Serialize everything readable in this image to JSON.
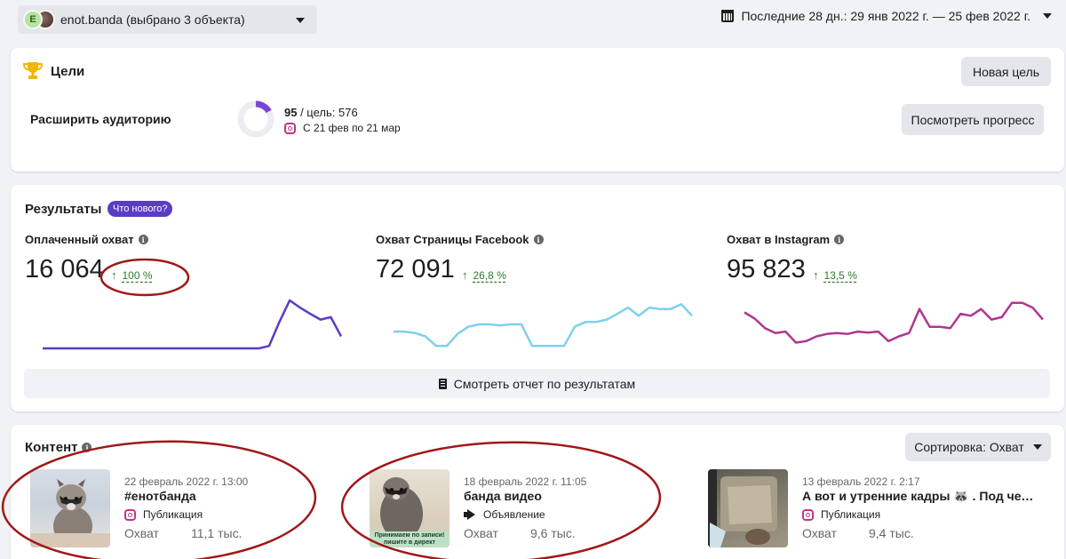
{
  "account": {
    "avatar_letter": "E",
    "label": "enot.banda (выбрано 3 объекта)"
  },
  "date_range": {
    "label": "Последние 28 дн.: 29 янв 2022 г. — 25 фев 2022 г."
  },
  "goals": {
    "title": "Цели",
    "new_goal_button": "Новая цель",
    "goal_name": "Расширить аудиторию",
    "current": "95",
    "target_text": " / цель: 576",
    "progress_fraction": 0.165,
    "dates": "С 21 фев по 21 мар",
    "view_progress_button": "Посмотреть прогресс"
  },
  "results": {
    "title": "Результаты",
    "whats_new": "Что нового?",
    "metrics": [
      {
        "label": "Оплаченный охват",
        "value": "16 064",
        "change": "100 %",
        "color": "#5b3cc4",
        "series": [
          0,
          0,
          0,
          0,
          0,
          0,
          0,
          0,
          0,
          0,
          0,
          0,
          0,
          0,
          0,
          0,
          0,
          0,
          0,
          0,
          0,
          0,
          0.05,
          0.55,
          1,
          0.85,
          0.72,
          0.6,
          0.65,
          0.25
        ]
      },
      {
        "label": "Охват Страницы Facebook",
        "value": "72 091",
        "change": "26,8 %",
        "color": "#7fd0ee",
        "series": [
          0.35,
          0.35,
          0.32,
          0.25,
          0.05,
          0.05,
          0.3,
          0.45,
          0.5,
          0.5,
          0.48,
          0.5,
          0.5,
          0.05,
          0.05,
          0.05,
          0.05,
          0.45,
          0.55,
          0.55,
          0.6,
          0.72,
          0.85,
          0.68,
          0.85,
          0.82,
          0.82,
          0.92,
          0.68
        ]
      },
      {
        "label": "Охват в Instagram",
        "value": "95 823",
        "change": "13,5 %",
        "color": "#b0368f",
        "series": [
          0.75,
          0.62,
          0.42,
          0.32,
          0.35,
          0.12,
          0.15,
          0.25,
          0.3,
          0.32,
          0.3,
          0.35,
          0.33,
          0.35,
          0.15,
          0.25,
          0.32,
          0.82,
          0.45,
          0.45,
          0.42,
          0.72,
          0.68,
          0.82,
          0.6,
          0.65,
          0.95,
          0.95,
          0.85,
          0.6
        ]
      }
    ],
    "report_button": "Смотреть отчет по результатам"
  },
  "content": {
    "title": "Контент",
    "sort_button": "Сортировка: Охват",
    "posts": [
      {
        "date": "22 февраль 2022 г. 13:00",
        "title": "#енотбанда",
        "type": "Публикация",
        "metric": "Охват",
        "value": "11,1 тыс."
      },
      {
        "date": "18 февраль 2022 г. 11:05",
        "title": "банда видео",
        "type": "Объявление",
        "metric": "Охват",
        "value": "9,6 тыс.",
        "thumb_caption": "Принимаем по записи! пишите в директ"
      },
      {
        "date": "13 февраль 2022 г. 2:17",
        "title": "А вот и утренние кадры 🦝 . Под четким руководством",
        "type": "Публикация",
        "metric": "Охват",
        "value": "9,4 тыс."
      }
    ]
  },
  "colors": {
    "accent": "#5b3cc4",
    "annotation": "#a01818",
    "trophy": "#f2b705"
  }
}
